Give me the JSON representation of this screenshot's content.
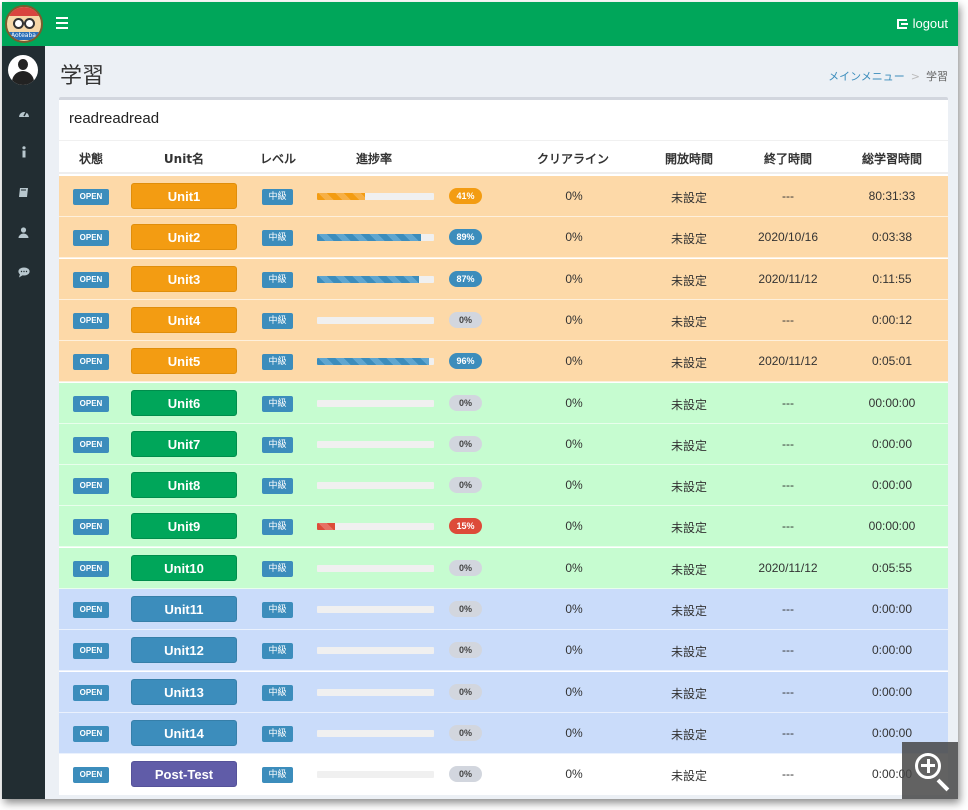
{
  "header": {
    "logo_text": "Aoteaba",
    "logout_label": "logout"
  },
  "sidebar": {
    "icons": [
      "dashboard-icon",
      "info-icon",
      "book-icon",
      "user-icon",
      "comment-icon"
    ]
  },
  "page": {
    "title": "学習",
    "breadcrumb": {
      "parent": "メインメニュー",
      "sep": ">",
      "current": "学習"
    }
  },
  "box": {
    "title": "readreadread",
    "columns": [
      "状態",
      "Unit名",
      "レベル",
      "進捗率",
      "クリアライン",
      "開放時間",
      "終了時間",
      "総学習時間"
    ]
  },
  "rows": [
    {
      "status": "OPEN",
      "unit": "Unit1",
      "level": "中級",
      "progress": 41,
      "progress_label": "41%",
      "clear": "0%",
      "open_time": "未設定",
      "end_time": "---",
      "total": "80:31:33",
      "color": "orange"
    },
    {
      "status": "OPEN",
      "unit": "Unit2",
      "level": "中級",
      "progress": 89,
      "progress_label": "89%",
      "clear": "0%",
      "open_time": "未設定",
      "end_time": "2020/10/16",
      "total": "0:03:38",
      "color": "orange"
    },
    {
      "status": "OPEN",
      "unit": "Unit3",
      "level": "中級",
      "progress": 87,
      "progress_label": "87%",
      "clear": "0%",
      "open_time": "未設定",
      "end_time": "2020/11/12",
      "total": "0:11:55",
      "color": "orange"
    },
    {
      "status": "OPEN",
      "unit": "Unit4",
      "level": "中級",
      "progress": 0,
      "progress_label": "0%",
      "clear": "0%",
      "open_time": "未設定",
      "end_time": "---",
      "total": "0:00:12",
      "color": "orange"
    },
    {
      "status": "OPEN",
      "unit": "Unit5",
      "level": "中級",
      "progress": 96,
      "progress_label": "96%",
      "clear": "0%",
      "open_time": "未設定",
      "end_time": "2020/11/12",
      "total": "0:05:01",
      "color": "orange"
    },
    {
      "status": "OPEN",
      "unit": "Unit6",
      "level": "中級",
      "progress": 0,
      "progress_label": "0%",
      "clear": "0%",
      "open_time": "未設定",
      "end_time": "---",
      "total": "00:00:00",
      "color": "green"
    },
    {
      "status": "OPEN",
      "unit": "Unit7",
      "level": "中級",
      "progress": 0,
      "progress_label": "0%",
      "clear": "0%",
      "open_time": "未設定",
      "end_time": "---",
      "total": "0:00:00",
      "color": "green"
    },
    {
      "status": "OPEN",
      "unit": "Unit8",
      "level": "中級",
      "progress": 0,
      "progress_label": "0%",
      "clear": "0%",
      "open_time": "未設定",
      "end_time": "---",
      "total": "0:00:00",
      "color": "green"
    },
    {
      "status": "OPEN",
      "unit": "Unit9",
      "level": "中級",
      "progress": 15,
      "progress_label": "15%",
      "clear": "0%",
      "open_time": "未設定",
      "end_time": "---",
      "total": "00:00:00",
      "color": "green"
    },
    {
      "status": "OPEN",
      "unit": "Unit10",
      "level": "中級",
      "progress": 0,
      "progress_label": "0%",
      "clear": "0%",
      "open_time": "未設定",
      "end_time": "2020/11/12",
      "total": "0:05:55",
      "color": "green"
    },
    {
      "status": "OPEN",
      "unit": "Unit11",
      "level": "中級",
      "progress": 0,
      "progress_label": "0%",
      "clear": "0%",
      "open_time": "未設定",
      "end_time": "---",
      "total": "0:00:00",
      "color": "blue"
    },
    {
      "status": "OPEN",
      "unit": "Unit12",
      "level": "中級",
      "progress": 0,
      "progress_label": "0%",
      "clear": "0%",
      "open_time": "未設定",
      "end_time": "---",
      "total": "0:00:00",
      "color": "blue"
    },
    {
      "status": "OPEN",
      "unit": "Unit13",
      "level": "中級",
      "progress": 0,
      "progress_label": "0%",
      "clear": "0%",
      "open_time": "未設定",
      "end_time": "---",
      "total": "0:00:00",
      "color": "blue"
    },
    {
      "status": "OPEN",
      "unit": "Unit14",
      "level": "中級",
      "progress": 0,
      "progress_label": "0%",
      "clear": "0%",
      "open_time": "未設定",
      "end_time": "---",
      "total": "0:00:00",
      "color": "blue"
    },
    {
      "status": "OPEN",
      "unit": "Post-Test",
      "level": "中級",
      "progress": 0,
      "progress_label": "0%",
      "clear": "0%",
      "open_time": "未設定",
      "end_time": "---",
      "total": "0:00:00",
      "color": "white"
    }
  ],
  "colors": {
    "header_green": "#00a65a",
    "sidebar_dark": "#222d32",
    "accent_blue": "#3c8dbc",
    "accent_orange": "#f39c12",
    "accent_red": "#dd4b39",
    "accent_purple": "#605ca8"
  },
  "overlay": {
    "icon": "zoom-in-icon"
  }
}
